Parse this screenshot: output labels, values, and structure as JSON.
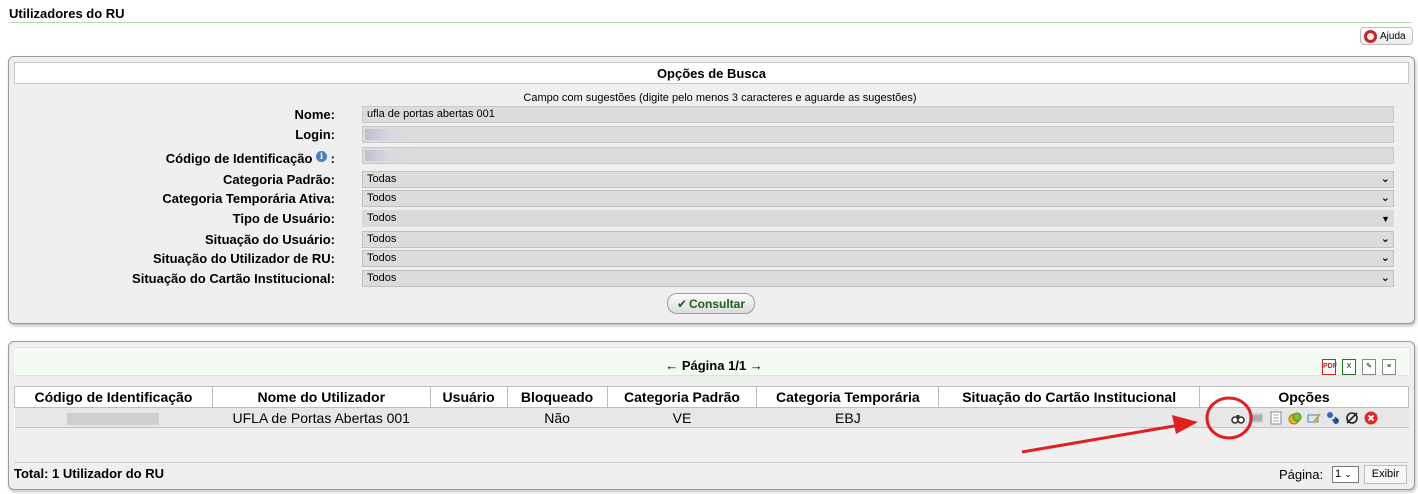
{
  "page": {
    "title": "Utilizadores do RU",
    "help_label": "Ajuda"
  },
  "search": {
    "header": "Opções de Busca",
    "hint": "Campo com sugestões (digite pelo menos 3 caracteres e aguarde as sugestões)",
    "fields": {
      "nome": {
        "label": "Nome:",
        "value": "ufla de portas abertas 001"
      },
      "login": {
        "label": "Login:",
        "value": ""
      },
      "codigo": {
        "label": "Código de Identificação",
        "suffix": ":",
        "value": ""
      },
      "categoria_padrao": {
        "label": "Categoria Padrão:",
        "value": "Todas"
      },
      "categoria_temporaria": {
        "label": "Categoria Temporária Ativa:",
        "value": "Todos"
      },
      "tipo_usuario": {
        "label": "Tipo de Usuário:",
        "value": "Todos"
      },
      "situacao_usuario": {
        "label": "Situação do Usuário:",
        "value": "Todos"
      },
      "situacao_utilizador": {
        "label": "Situação do Utilizador de RU:",
        "value": "Todos"
      },
      "situacao_cartao": {
        "label": "Situação do Cartão Institucional:",
        "value": "Todos"
      }
    },
    "submit_label": "Consultar"
  },
  "results": {
    "pager": "← Página 1/1 →",
    "columns": [
      "Código de Identificação",
      "Nome do Utilizador",
      "Usuário",
      "Bloqueado",
      "Categoria Padrão",
      "Categoria Temporária",
      "Situação do Cartão Institucional",
      "Opções"
    ],
    "rows": [
      {
        "codigo": "",
        "nome": "UFLA de Portas Abertas 001",
        "usuario": "",
        "bloqueado": "Não",
        "categoria_padrao": "VE",
        "categoria_temporaria": "EBJ",
        "situacao_cartao": ""
      }
    ],
    "total": "Total: 1 Utilizador do RU",
    "page_label": "Página:",
    "page_select": "1",
    "exibir_label": "Exibir"
  },
  "colors": {
    "annotation": "#e02020",
    "header_green": "#f4fbf2"
  },
  "icons": {
    "export": [
      "pdf-icon",
      "excel-icon",
      "edit-report-icon",
      "print-icon"
    ],
    "options": [
      "binoculars-icon",
      "barcode-icon",
      "calculator-icon",
      "coins-icon",
      "card-edit-icon",
      "transfer-icon",
      "block-icon",
      "delete-icon"
    ]
  }
}
